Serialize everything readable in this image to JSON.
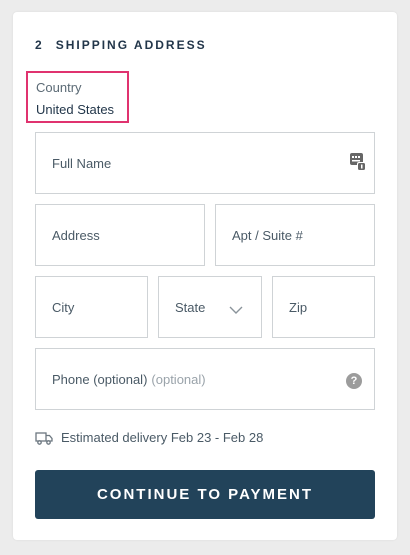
{
  "section": {
    "number": "2",
    "title": "SHIPPING ADDRESS"
  },
  "country": {
    "label": "Country",
    "value": "United States"
  },
  "fields": {
    "full_name": {
      "placeholder": "Full Name",
      "icon": "contact-card-icon"
    },
    "address": {
      "placeholder": "Address"
    },
    "apt": {
      "placeholder": "Apt / Suite #"
    },
    "city": {
      "placeholder": "City"
    },
    "state": {
      "placeholder": "State",
      "icon": "chevron-down-icon"
    },
    "zip": {
      "placeholder": "Zip"
    },
    "phone": {
      "placeholder": "Phone (optional)",
      "hint": "(optional)",
      "icon": "help-icon",
      "help_glyph": "?"
    }
  },
  "delivery": {
    "icon": "truck-icon",
    "text": "Estimated delivery Feb 23 - Feb 28"
  },
  "cta": {
    "label": "CONTINUE TO PAYMENT"
  },
  "colors": {
    "accent_highlight": "#e0336f",
    "button_bg": "#22435a",
    "heading": "#22364a"
  }
}
